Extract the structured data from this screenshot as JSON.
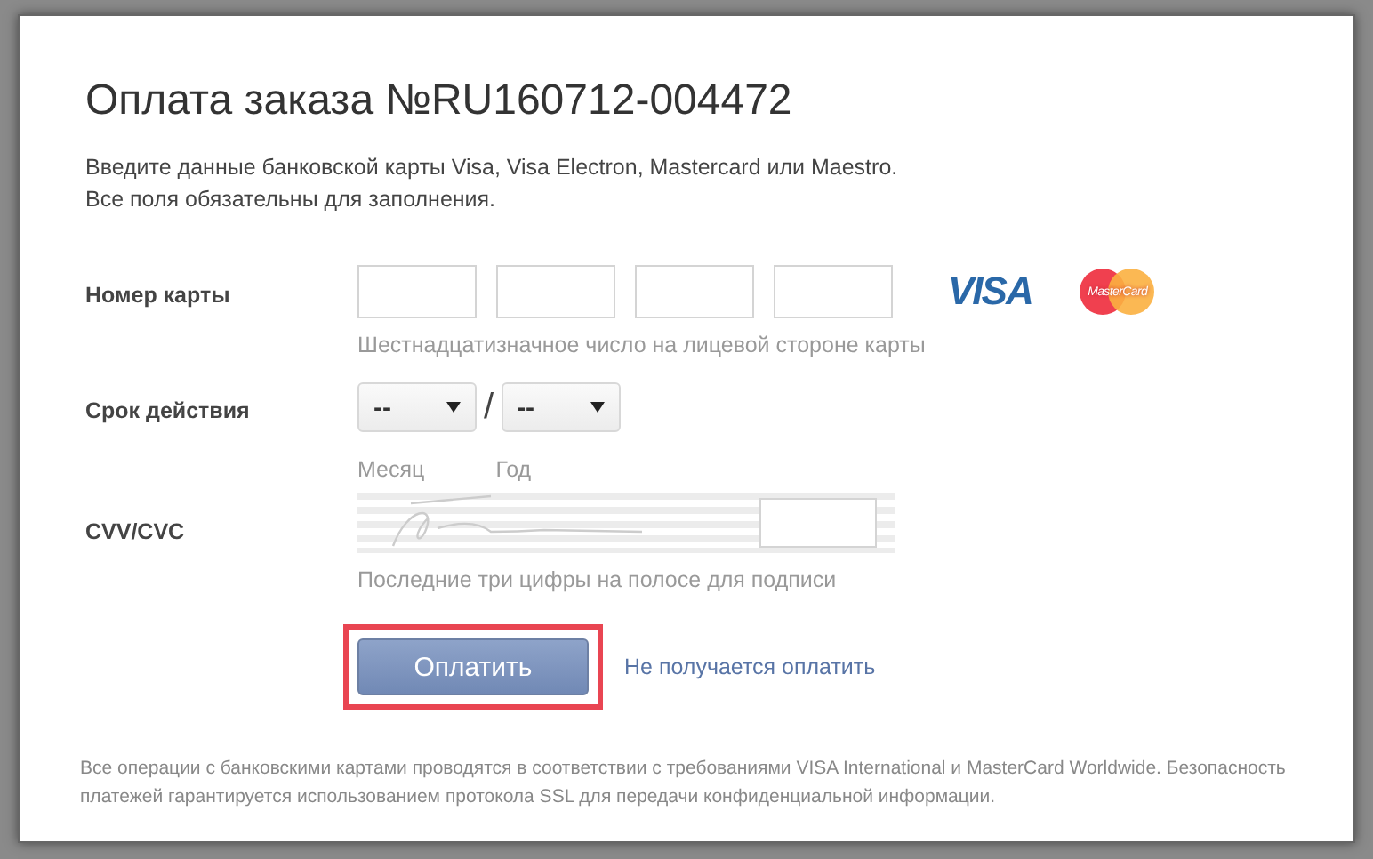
{
  "dialog": {
    "title": "Оплата заказа №RU160712-004472",
    "intro": [
      "Введите данные банковской карты Visa, Visa Electron, Mastercard или Maestro.",
      "Все поля обязательны для заполнения."
    ]
  },
  "card_number": {
    "label": "Номер карты",
    "fields": [
      {
        "kind": "digits"
      },
      {
        "kind": "digits"
      },
      {
        "kind": "digits"
      },
      {
        "kind": "digits"
      }
    ],
    "hint": "Шестнадцатизначное число на лицевой стороне карты",
    "logos": [
      {
        "kind": "visa",
        "text": "VISA"
      },
      {
        "kind": "mastercard",
        "text": "MasterCard"
      }
    ]
  },
  "expiry": {
    "label": "Срок действия",
    "separator": "/",
    "selects": [
      {
        "value": "--",
        "hint": "Месяц"
      },
      {
        "value": "--",
        "hint": "Год"
      }
    ]
  },
  "cvv": {
    "label": "CVV/CVC",
    "hint": "Последние три цифры на полосе для подписи"
  },
  "pay_button": {
    "label": "Оплатить",
    "highlighted": true
  },
  "help_link": "Не получается оплатить",
  "footer": "Все операции с банковскими картами проводятся в соответствии с требованиями VISA International и MasterCard Worldwide. Безопасность платежей гарантируется использованием протокола SSL для передачи конфиденциальной информации."
}
